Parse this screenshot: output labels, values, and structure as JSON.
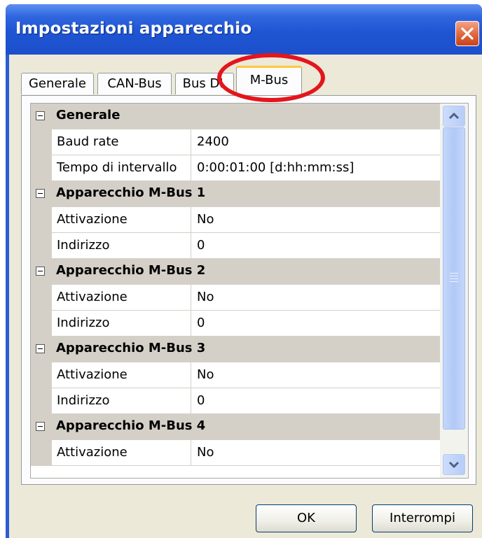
{
  "window": {
    "title": "Impostazioni apparecchio"
  },
  "tabs": [
    {
      "label": "Generale",
      "active": false
    },
    {
      "label": "CAN-Bus",
      "active": false
    },
    {
      "label": "Bus DL",
      "active": false
    },
    {
      "label": "M-Bus",
      "active": true
    }
  ],
  "grid": {
    "rows": [
      {
        "type": "category",
        "label": "Generale"
      },
      {
        "type": "property",
        "name": "Baud rate",
        "value": "2400"
      },
      {
        "type": "property",
        "name": "Tempo di intervallo",
        "value": "0:00:01:00 [d:hh:mm:ss]"
      },
      {
        "type": "category",
        "label": "Apparecchio M-Bus 1"
      },
      {
        "type": "property",
        "name": "Attivazione",
        "value": "No"
      },
      {
        "type": "property",
        "name": "Indirizzo",
        "value": "0"
      },
      {
        "type": "category",
        "label": "Apparecchio M-Bus 2"
      },
      {
        "type": "property",
        "name": "Attivazione",
        "value": "No"
      },
      {
        "type": "property",
        "name": "Indirizzo",
        "value": "0"
      },
      {
        "type": "category",
        "label": "Apparecchio M-Bus 3"
      },
      {
        "type": "property",
        "name": "Attivazione",
        "value": "No"
      },
      {
        "type": "property",
        "name": "Indirizzo",
        "value": "0"
      },
      {
        "type": "category",
        "label": "Apparecchio M-Bus 4"
      },
      {
        "type": "property",
        "name": "Attivazione",
        "value": "No"
      }
    ]
  },
  "buttons": {
    "ok": "OK",
    "cancel": "Interrompi"
  },
  "icons": {
    "close": "close-icon",
    "collapse": "minus-box-icon",
    "scroll_up": "chevron-up-icon",
    "scroll_down": "chevron-down-icon"
  },
  "colors": {
    "titlebar": "#1f55d3",
    "highlight": "#e4151c",
    "tab_active_accent": "#ffc83c"
  }
}
